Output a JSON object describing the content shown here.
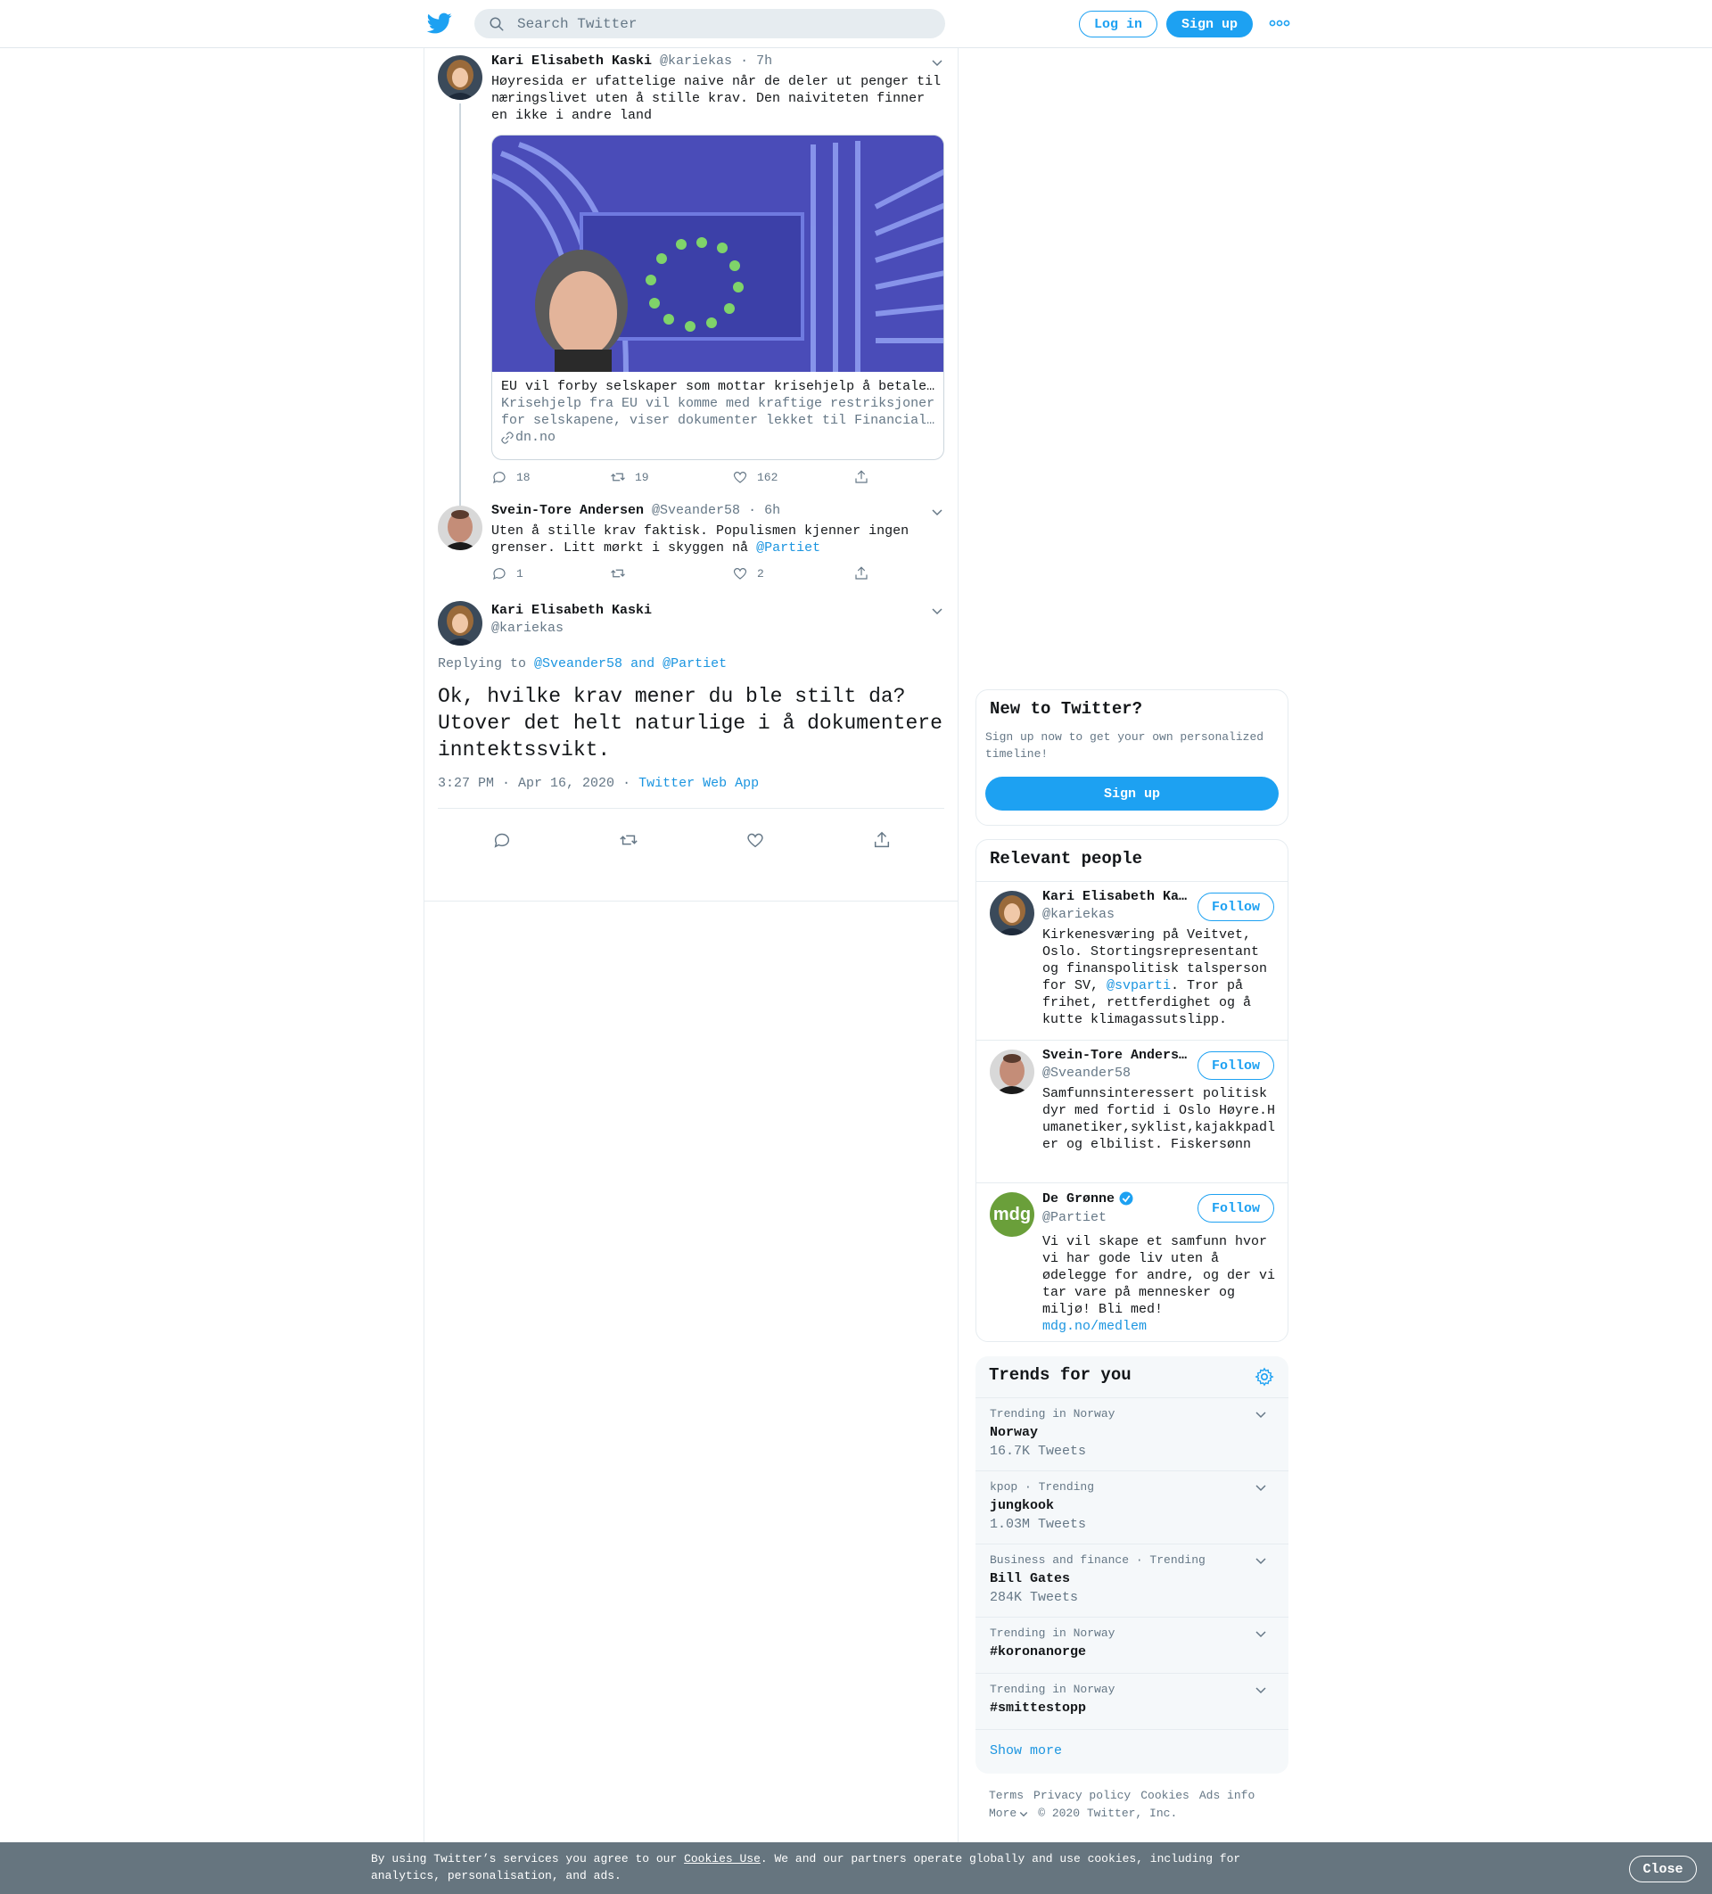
{
  "header": {
    "search_placeholder": "Search Twitter",
    "login_label": "Log in",
    "signup_label": "Sign up",
    "icons": [
      "twitter-bird-icon",
      "search-icon",
      "more-icon"
    ]
  },
  "thread": {
    "tweet1": {
      "name": "Kari Elisabeth Kaski",
      "handle": "@kariekas",
      "time": "· 7h",
      "text_line1": "Høyresida er ufattelige naive når de deler ut penger til",
      "text_line2": "næringslivet uten å stille krav. Den naiviteten finner",
      "text_line3": "en ikke i andre land",
      "card": {
        "title": "EU vil forby selskaper som mottar krisehjelp å betale…",
        "desc_line1": "Krisehjelp fra EU vil komme med kraftige restriksjoner",
        "desc_line2": "for selskapene, viser dokumenter lekket til Financial…",
        "domain": "dn.no"
      },
      "replies": "18",
      "retweets": "19",
      "likes": "162"
    },
    "tweet2": {
      "name": "Svein-Tore Andersen",
      "handle": "@Sveander58",
      "time": "· 6h",
      "text_line1": "Uten å stille krav faktisk. Populismen kjenner ingen",
      "text_line2": "grenser.  Litt mørkt i skyggen nå",
      "mention": "@Partiet",
      "replies": "1",
      "retweets": "",
      "likes": "2"
    },
    "main_tweet": {
      "name": "Kari Elisabeth Kaski",
      "handle": "@kariekas",
      "replying_label": "Replying to",
      "replying_to": "@Sveander58 and @Partiet",
      "text": "Ok, hvilke krav mener du ble stilt da? Utover det helt naturlige i å dokumentere inntektssvikt.",
      "timestamp": "3:27 PM · Apr 16, 2020",
      "dot": "·",
      "source": "Twitter Web App"
    }
  },
  "new_to_twitter": {
    "title": "New to Twitter?",
    "subtitle": "Sign up now to get your own personalized timeline!",
    "button": "Sign up"
  },
  "relevant_people": {
    "title": "Relevant people",
    "people": [
      {
        "name": "Kari Elisabeth Ka…",
        "handle": "@kariekas",
        "bio_before": "Kirkenesværing på Veitvet, Oslo. Stortingsrepresentant og finanspolitisk talsperson for SV,",
        "bio_link": "@svparti",
        "bio_after": ". Tror på frihet, rettferdighet og å kutte klimagassutslipp.",
        "follow": "Follow"
      },
      {
        "name": "Svein-Tore Anders…",
        "handle": "@Sveander58",
        "bio": "Samfunnsinteressert politisk dyr med fortid i Oslo Høyre.Humanetiker,syklist,kajakkpadler og elbilist. Fiskersønn",
        "follow": "Follow"
      },
      {
        "name": "De Grønne",
        "handle": "@Partiet",
        "avatar_text": "mdg",
        "bio": "Vi vil skape et samfunn hvor vi har gode liv uten å ødelegge for andre, og der vi tar vare på mennesker og miljø! Bli med!",
        "bio_link": "mdg.no/medlem",
        "follow": "Follow"
      }
    ]
  },
  "trends": {
    "title": "Trends for you",
    "items": [
      {
        "context": "Trending in Norway",
        "name": "Norway",
        "count": "16.7K Tweets"
      },
      {
        "context": "kpop · Trending",
        "name": "jungkook",
        "count": "1.03M Tweets"
      },
      {
        "context": "Business and finance · Trending",
        "name": "Bill Gates",
        "count": "284K Tweets"
      },
      {
        "context": "Trending in Norway",
        "name": "#koronanorge",
        "count": ""
      },
      {
        "context": "Trending in Norway",
        "name": "#smittestopp",
        "count": ""
      }
    ],
    "show_more": "Show more"
  },
  "footer": {
    "links": [
      "Terms",
      "Privacy policy",
      "Cookies",
      "Ads info"
    ],
    "more": "More",
    "copyright": "© 2020 Twitter, Inc."
  },
  "cookie_banner": {
    "text_before": "By using Twitter’s services you agree to our",
    "link": "Cookies Use",
    "text_after": ". We and our partners operate globally and use cookies, including for analytics, personalisation, and ads.",
    "close": "Close"
  },
  "colors": {
    "accent": "#1da1f2",
    "link": "#1b95e0",
    "muted": "#657786",
    "cookie_bar": "#66757f",
    "mdg_green": "#6a9f3a"
  }
}
